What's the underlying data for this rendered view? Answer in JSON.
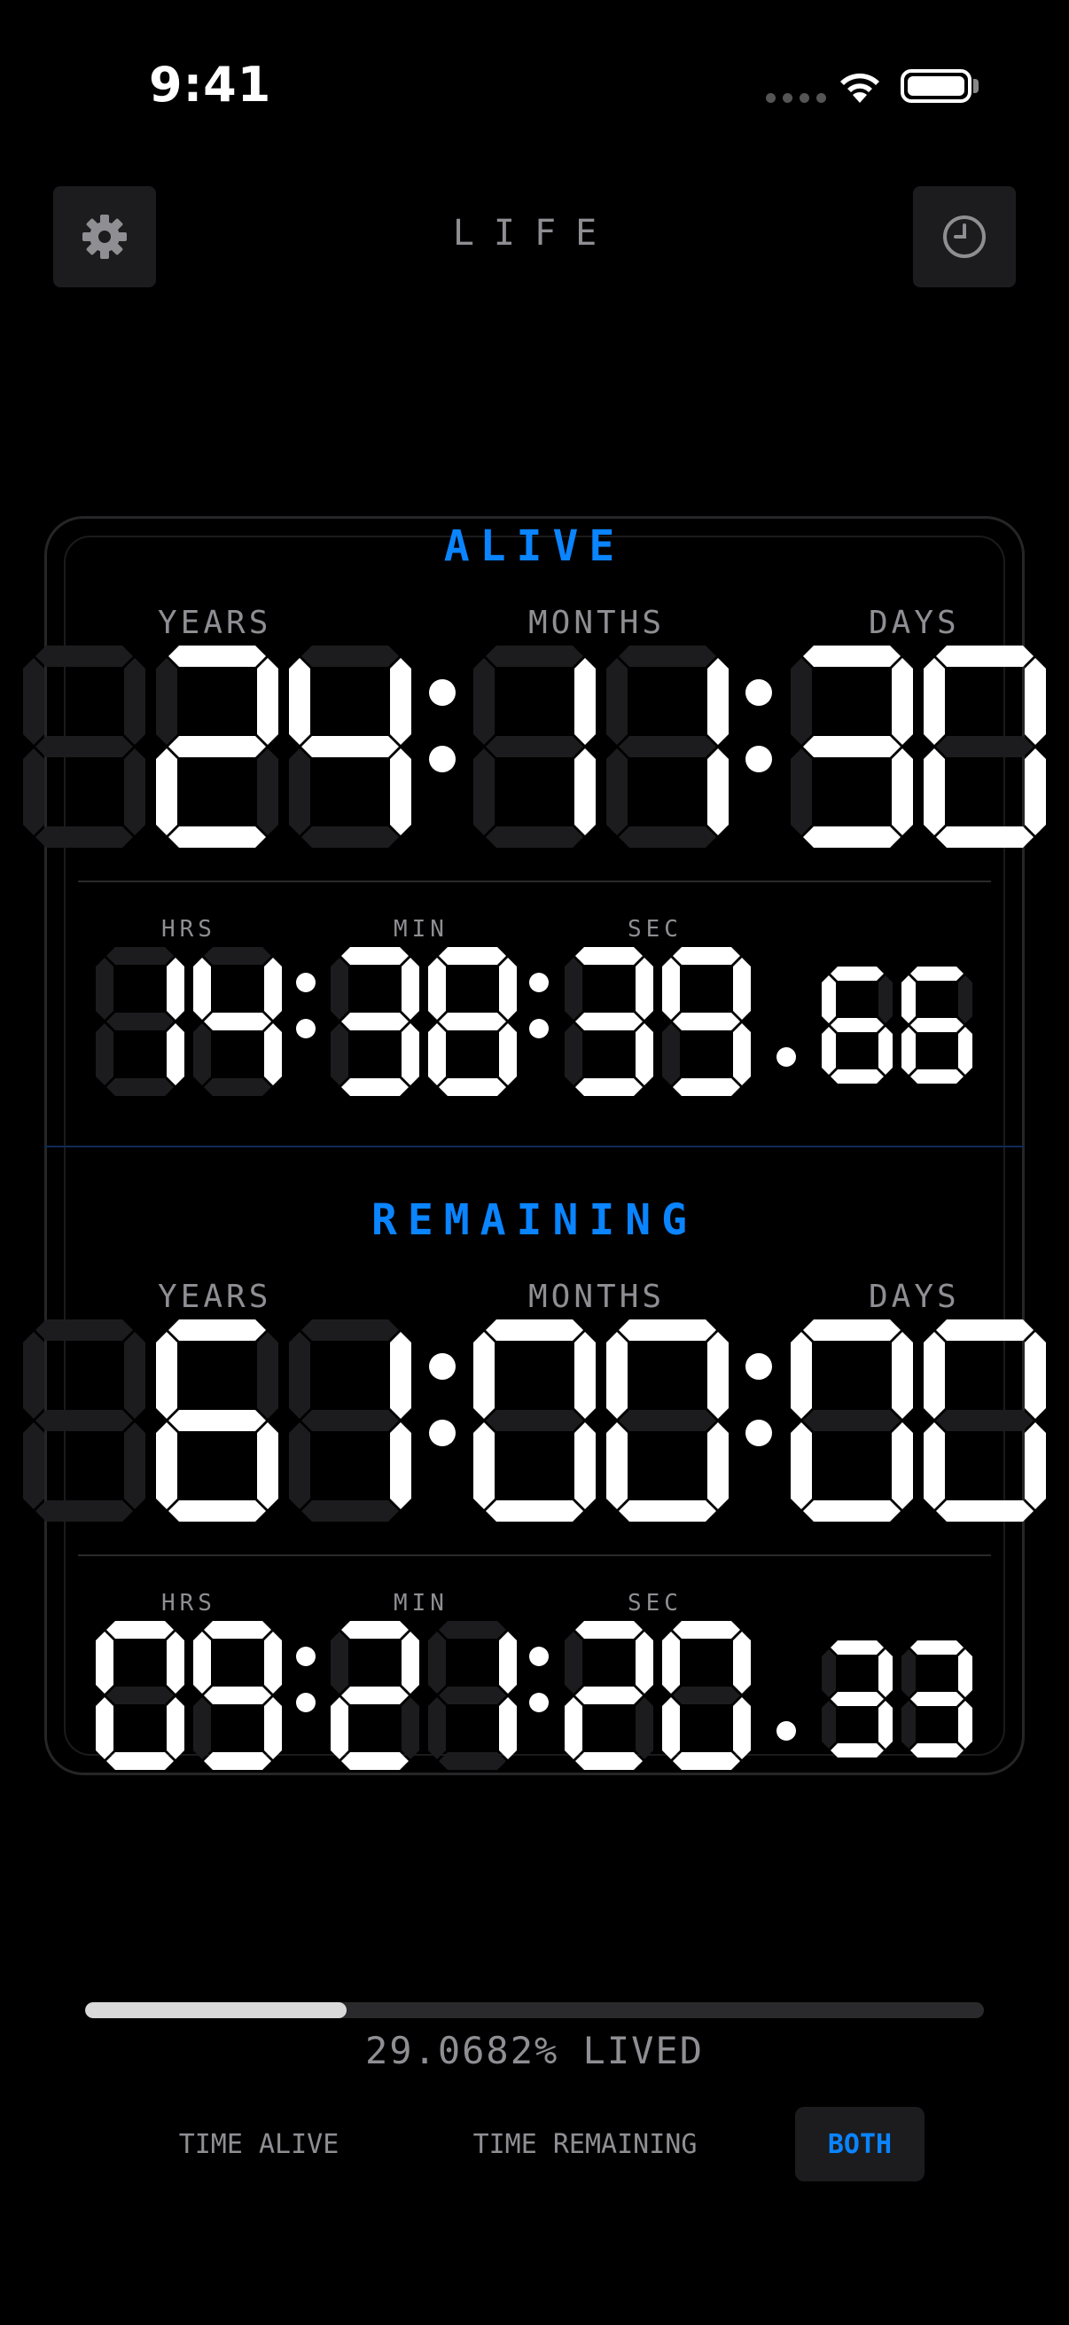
{
  "status": {
    "time": "9:41"
  },
  "header": {
    "title": "LIFE",
    "settings_icon": "gear-icon",
    "history_icon": "clock-icon"
  },
  "alive": {
    "title": "ALIVE",
    "labels": {
      "years": "YEARS",
      "months": "MONTHS",
      "days": "DAYS",
      "hrs": "HRS",
      "min": "MIN",
      "sec": "SEC"
    },
    "years": "24",
    "months": "11",
    "days": "30",
    "hours": "14",
    "minutes": "38",
    "seconds": "39",
    "hundredths": "66"
  },
  "remaining": {
    "title": "REMAINING",
    "labels": {
      "years": "YEARS",
      "months": "MONTHS",
      "days": "DAYS",
      "hrs": "HRS",
      "min": "MIN",
      "sec": "SEC"
    },
    "years": "61",
    "months": "00",
    "days": "00",
    "hours": "09",
    "minutes": "21",
    "seconds": "20",
    "hundredths": "33"
  },
  "progress": {
    "fraction": 0.290682,
    "text": "29.0682% LIVED"
  },
  "modes": [
    {
      "label": "TIME ALIVE",
      "active": false
    },
    {
      "label": "TIME REMAINING",
      "active": false
    },
    {
      "label": "BOTH",
      "active": true
    }
  ],
  "colors": {
    "accent": "#0a84ff",
    "digit_on": "#ffffff",
    "digit_off": "#1c1c1e",
    "label": "#8e8e93"
  }
}
